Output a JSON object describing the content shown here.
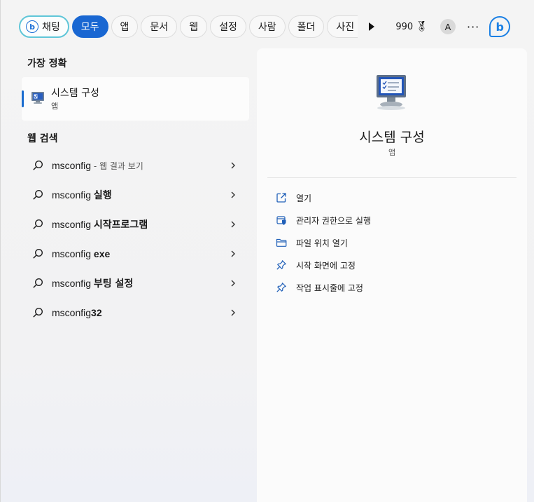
{
  "tabs": {
    "chat_label": "채팅",
    "items": [
      "모두",
      "앱",
      "문서",
      "웹",
      "설정",
      "사람",
      "폴더",
      "사진"
    ],
    "active_index": 0,
    "points": "990",
    "avatar_letter": "A",
    "more": "···"
  },
  "best_match": {
    "heading": "가장 정확",
    "title": "시스템 구성",
    "subtitle": "앱"
  },
  "web_search": {
    "heading": "웹 검색",
    "results": [
      {
        "query": "msconfig",
        "suffix": "",
        "hint": " - 웹 결과 보기"
      },
      {
        "query": "msconfig ",
        "suffix": "실행",
        "hint": ""
      },
      {
        "query": "msconfig ",
        "suffix": "시작프로그램",
        "hint": ""
      },
      {
        "query": "msconfig ",
        "suffix": "exe",
        "hint": ""
      },
      {
        "query": "msconfig ",
        "suffix": "부팅 설정",
        "hint": ""
      },
      {
        "query": "msconfig",
        "suffix": "32",
        "hint": ""
      }
    ]
  },
  "detail": {
    "title": "시스템 구성",
    "subtitle": "앱",
    "actions": [
      {
        "label": "열기",
        "icon": "open-external-icon"
      },
      {
        "label": "관리자 권한으로 실행",
        "icon": "shield-admin-icon"
      },
      {
        "label": "파일 위치 열기",
        "icon": "folder-icon"
      },
      {
        "label": "시작 화면에 고정",
        "icon": "pin-icon"
      },
      {
        "label": "작업 표시줄에 고정",
        "icon": "pin-icon"
      }
    ]
  },
  "colors": {
    "accent": "#1967d2",
    "chat_border": "#5fc6d8",
    "action_icon": "#1f5fb8"
  }
}
